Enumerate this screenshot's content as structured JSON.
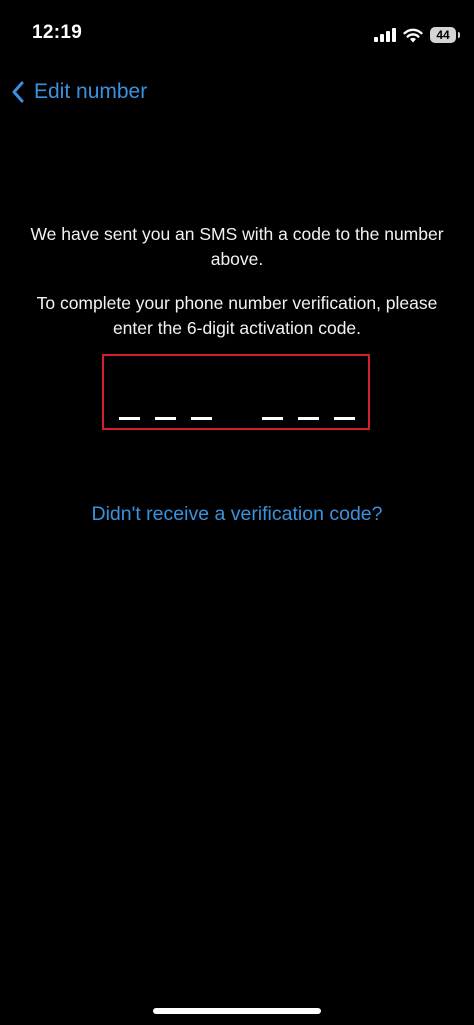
{
  "status_bar": {
    "time": "12:19",
    "battery": "44",
    "icons": [
      "signal-icon",
      "wifi-icon",
      "battery-icon"
    ]
  },
  "nav": {
    "back_label": "Edit number",
    "back_icon": "chevron-left-icon"
  },
  "content": {
    "message_1": "We have sent you an SMS with a code to the number above.",
    "message_2": "To complete your phone number verification, please enter the 6-digit activation code.",
    "resend_link": "Didn't receive a verification code?"
  },
  "code_input": {
    "digits": 6,
    "entered": ""
  },
  "colors": {
    "background": "#000000",
    "text": "#f2f2f2",
    "accent": "#3a92df",
    "highlight_border": "#d2202a"
  }
}
